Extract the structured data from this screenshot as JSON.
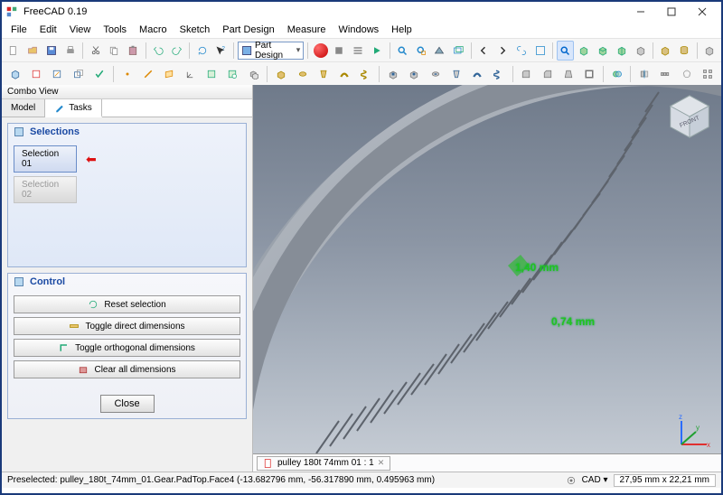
{
  "window": {
    "title": "FreeCAD 0.19"
  },
  "menu": {
    "items": [
      "File",
      "Edit",
      "View",
      "Tools",
      "Macro",
      "Sketch",
      "Part Design",
      "Measure",
      "Windows",
      "Help"
    ]
  },
  "workbench": {
    "label": "Part Design"
  },
  "combo": {
    "title": "Combo View",
    "tabs": {
      "model": "Model",
      "tasks": "Tasks"
    },
    "selections": {
      "header": "Selections",
      "items": [
        "Selection 01",
        "Selection 02"
      ]
    },
    "control": {
      "header": "Control",
      "reset": "Reset selection",
      "toggle_direct": "Toggle direct dimensions",
      "toggle_ortho": "Toggle orthogonal dimensions",
      "clear": "Clear all dimensions",
      "close": "Close"
    }
  },
  "viewport": {
    "tab_label": "pulley 180t 74mm 01 : 1",
    "dim1": "1,40 mm",
    "dim2": "0,74 mm",
    "navcube_face": "FRONT"
  },
  "status": {
    "preselected": "Preselected: pulley_180t_74mm_01.Gear.PadTop.Face4 (-13.682796 mm, -56.317890 mm, 0.495963 mm)",
    "cad_label": "CAD",
    "dims": "27,95 mm x 22,21 mm"
  },
  "colors": {
    "accent": "#1b4aa3",
    "green": "#23c31f",
    "red": "#d11"
  }
}
